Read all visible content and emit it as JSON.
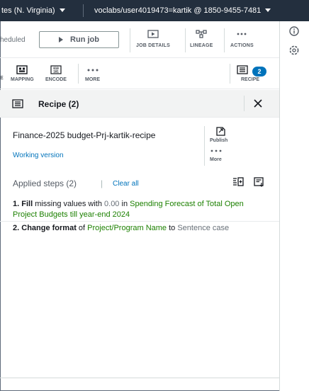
{
  "topbar": {
    "region": "tes (N. Virginia)",
    "account": "voclabs/user4019473=kartik @ 1850-9455-7481"
  },
  "jobbar": {
    "scheduled": "heduled",
    "run_job": "Run job",
    "job_details": "JOB DETAILS",
    "lineage": "LINEAGE",
    "actions": "ACTIONS"
  },
  "transforms": {
    "partial": "E",
    "mapping": "MAPPING",
    "encode": "ENCODE",
    "more": "MORE",
    "recipe": "RECIPE",
    "recipe_count": "2"
  },
  "recipe_panel": {
    "title": "Recipe (2)",
    "name": "Finance-2025 budget-Prj-kartik-recipe",
    "version": "Working version",
    "publish": "Publish",
    "more": "More",
    "applied_steps": "Applied steps (2)",
    "divider": "|",
    "clear_all": "Clear all",
    "steps": [
      {
        "num": "1.",
        "verb": "Fill",
        "t1": " missing values with ",
        "value": "0.00",
        "t2": " in ",
        "column": "Spending Forecast of Total Open Project Budgets till year-end 2024"
      },
      {
        "num": "2.",
        "verb": "Change format",
        "t1": " of ",
        "column": "Project/Program Name",
        "t2": " to ",
        "value": "Sentence case"
      }
    ]
  },
  "colors": {
    "topbar_bg": "#232f3e",
    "link": "#0073bb",
    "column_green": "#1d8102",
    "badge_blue": "#0073bb"
  },
  "icons": [
    "caret-down-icon",
    "info-icon",
    "settings-icon",
    "play-icon",
    "job-details-icon",
    "lineage-icon",
    "actions-ellipsis-icon",
    "mapping-icon",
    "encode-icon",
    "more-ellipsis-icon",
    "recipe-list-icon",
    "close-icon",
    "publish-icon",
    "import-steps-icon",
    "download-steps-icon"
  ]
}
